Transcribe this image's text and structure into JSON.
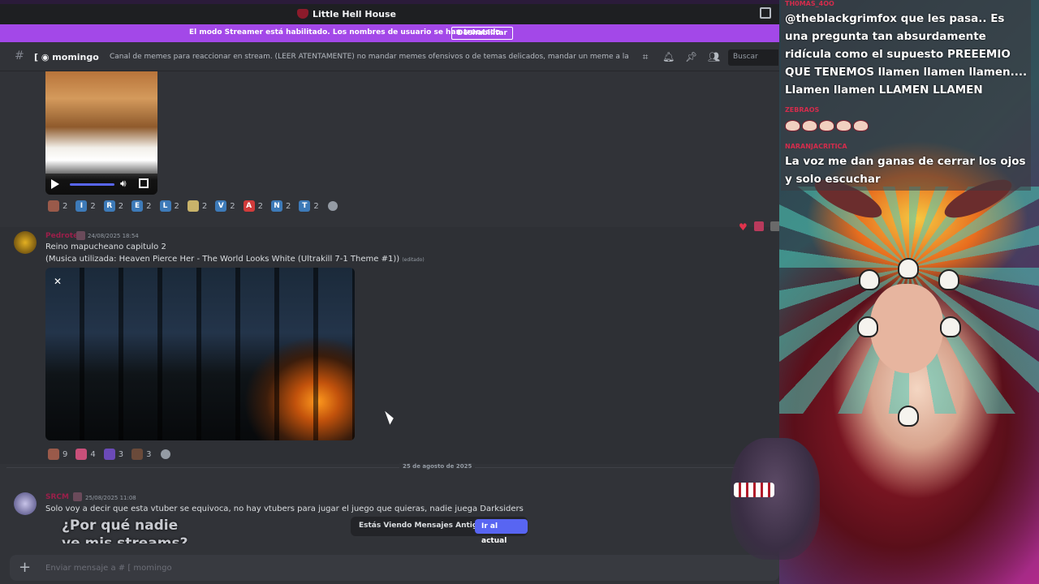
{
  "window": {
    "title": "Little Hell House"
  },
  "banner": {
    "text": "El modo Streamer está habilitado. Los nombres de usuario se han truncado.",
    "button": "Deshabilitar"
  },
  "channel": {
    "name": "momingo",
    "prefix": "[",
    "topic": "Canal de memes para reaccionar en stream. (LEER ATENTAMENTE) no mandar memes ofensivos o de temas delicados, mandar un meme a la vez , ver qu...",
    "search_placeholder": "Buscar"
  },
  "message1": {
    "reactions": [
      {
        "emoji": "avatar",
        "count": "2",
        "color": "#9a5a4a"
      },
      {
        "emoji": "I",
        "count": "2",
        "color": "#3d7ab8"
      },
      {
        "emoji": "R",
        "count": "2",
        "color": "#3d7ab8"
      },
      {
        "emoji": "E",
        "count": "2",
        "color": "#3d7ab8"
      },
      {
        "emoji": "L",
        "count": "2",
        "color": "#3d7ab8"
      },
      {
        "emoji": "moon",
        "count": "2",
        "color": "#c9b36a"
      },
      {
        "emoji": "V",
        "count": "2",
        "color": "#3d7ab8"
      },
      {
        "emoji": "A",
        "count": "2",
        "color": "#d13b3b"
      },
      {
        "emoji": "N",
        "count": "2",
        "color": "#3d7ab8"
      },
      {
        "emoji": "T",
        "count": "2",
        "color": "#3d7ab8"
      }
    ]
  },
  "message2": {
    "author": "Pedrote",
    "timestamp": "24/08/2025 18:54",
    "line1": "Reino mapucheano capitulo 2",
    "line2": "(Musica utilizada: Heaven Pierce Her - The World Looks White (Ultrakill 7-1 Theme #1))",
    "edited": "(editado)",
    "reactions": [
      {
        "emoji": "avatar",
        "count": "9",
        "color": "#9a5a4a"
      },
      {
        "emoji": "face",
        "count": "4",
        "color": "#c9507a"
      },
      {
        "emoji": "purple",
        "count": "3",
        "color": "#6b4ab8"
      },
      {
        "emoji": "figure",
        "count": "3",
        "color": "#6a4a3a"
      }
    ]
  },
  "date_divider": "25 de agosto de 2025",
  "message3": {
    "author": "SRCM",
    "timestamp": "25/08/2025 11:08",
    "text": "Solo voy a decir que esta vtuber se equivoca, no hay vtubers para jugar el juego que quieras, nadie juega Darksiders",
    "image_text_1": "¿Por qué nadie",
    "image_text_2": "ve mis streams?"
  },
  "old_messages": {
    "label": "Estás Viendo Mensajes Antiguos",
    "button": "Ir al actual"
  },
  "composer": {
    "placeholder": "Enviar mensaje a # [ momingo"
  },
  "stream_chat": [
    {
      "user": "TH0MAS_4OO",
      "text": "@theblackgrimfox que les pasa.. Es una pregunta tan absurdamente ridícula como el supuesto PREEEMIO QUE TENEMOS llamen llamen llamen.... Llamen llamen LLAMEN LLAMEN"
    },
    {
      "user": "ZEBRAOS",
      "text": ""
    },
    {
      "user": "NARANJACRITICA",
      "text": "La voz me dan ganas de cerrar los ojos y solo escuchar"
    }
  ],
  "colors": {
    "streamer_banner": "#a348e8",
    "accent": "#5865f2",
    "background": "#313338"
  }
}
